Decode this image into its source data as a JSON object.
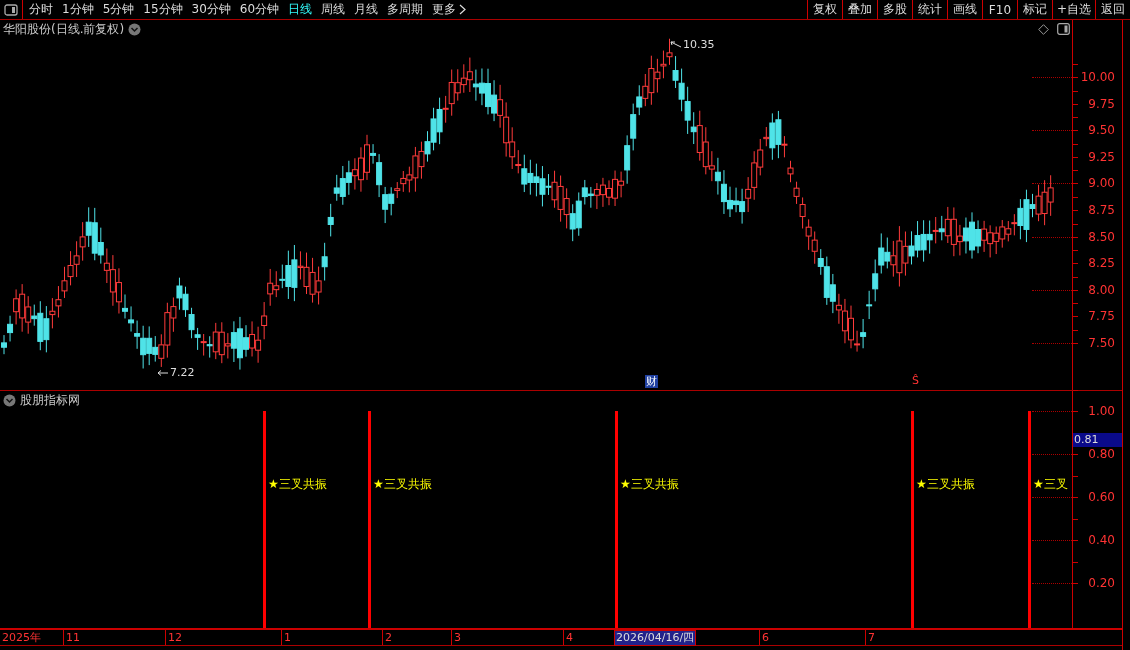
{
  "toolbar": {
    "periods": [
      {
        "label": "分时",
        "selected": false
      },
      {
        "label": "1分钟",
        "selected": false
      },
      {
        "label": "5分钟",
        "selected": false
      },
      {
        "label": "15分钟",
        "selected": false
      },
      {
        "label": "30分钟",
        "selected": false
      },
      {
        "label": "60分钟",
        "selected": false
      },
      {
        "label": "日线",
        "selected": true
      },
      {
        "label": "周线",
        "selected": false
      },
      {
        "label": "月线",
        "selected": false
      },
      {
        "label": "多周期",
        "selected": false
      }
    ],
    "more": "更多",
    "buttons": [
      "复权",
      "叠加",
      "多股",
      "统计",
      "画线",
      "F10",
      "标记",
      "+自选",
      "返回"
    ]
  },
  "price_chart": {
    "title": "华阳股份(日线.前复权)",
    "yticks": [
      "10.00",
      "9.75",
      "9.50",
      "9.25",
      "9.00",
      "8.75",
      "8.50",
      "8.25",
      "8.00",
      "7.75",
      "7.50"
    ],
    "high_label": "10.35",
    "low_label": "7.22",
    "markers": [
      {
        "kind": "finance",
        "text": "财"
      },
      {
        "kind": "signal",
        "text": "Ŝ"
      }
    ]
  },
  "indicator": {
    "title": "股朋指标网",
    "yticks": [
      "1.00",
      "0.80",
      "0.60",
      "0.40",
      "0.20"
    ],
    "cursor_value": "0.81",
    "signals": [
      "★三叉共振",
      "★三叉共振",
      "★三叉共振",
      "★三叉共振",
      "★三叉"
    ]
  },
  "date_axis": {
    "labels": [
      "2025年",
      "11",
      "12",
      "1",
      "2",
      "3",
      "4",
      "6",
      "7"
    ],
    "cursor_date": "2026/04/16/四"
  }
}
